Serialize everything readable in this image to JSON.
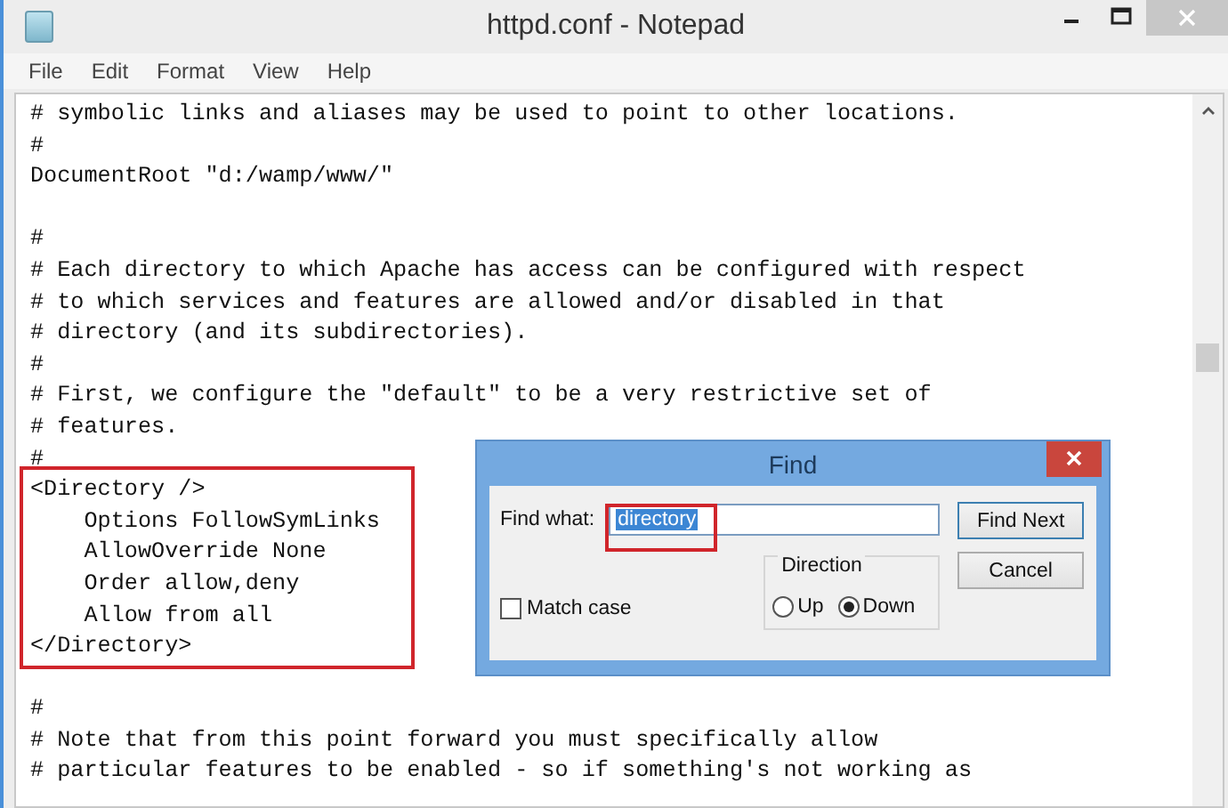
{
  "window": {
    "title": "httpd.conf - Notepad"
  },
  "menu": [
    "File",
    "Edit",
    "Format",
    "View",
    "Help"
  ],
  "editor": {
    "lines": [
      {
        "kind": "text",
        "text": "# symbolic links and aliases may be used to point to other locations."
      },
      {
        "kind": "text",
        "text": "#"
      },
      {
        "kind": "text",
        "text": "DocumentRoot \"d:/wamp/www/\""
      },
      {
        "kind": "blank"
      },
      {
        "kind": "text",
        "text": "#"
      },
      {
        "kind": "text",
        "text": "# Each directory to which Apache has access can be configured with respect"
      },
      {
        "kind": "text",
        "text": "# to which services and features are allowed and/or disabled in that"
      },
      {
        "kind": "text",
        "text": "# directory (and its subdirectories)."
      },
      {
        "kind": "text",
        "text": "#"
      },
      {
        "kind": "text",
        "text": "# First, we configure the \"default\" to be a very restrictive set of"
      },
      {
        "kind": "text",
        "text": "# features."
      },
      {
        "kind": "text",
        "text": "#"
      },
      {
        "kind": "text",
        "text": "<Directory />"
      },
      {
        "kind": "text",
        "text": "    Options FollowSymLinks"
      },
      {
        "kind": "text",
        "text": "    AllowOverride None"
      },
      {
        "kind": "text",
        "text": "    Order allow,deny"
      },
      {
        "kind": "text",
        "text": "    Allow from all"
      },
      {
        "kind": "text",
        "text": "</Directory>"
      },
      {
        "kind": "blank"
      },
      {
        "kind": "text",
        "text": "#"
      },
      {
        "kind": "text",
        "text": "# Note that from this point forward you must specifically allow"
      },
      {
        "kind": "text",
        "text": "# particular features to be enabled - so if something's not working as"
      }
    ]
  },
  "find_dialog": {
    "title": "Find",
    "find_what_label": "Find what:",
    "find_what_value": "directory",
    "value_selected": true,
    "match_case": {
      "label": "Match case",
      "checked": false
    },
    "direction": {
      "label": "Direction",
      "options": [
        {
          "label": "Up",
          "selected": false
        },
        {
          "label": "Down",
          "selected": true
        }
      ]
    },
    "buttons": [
      "Find Next",
      "Cancel"
    ]
  }
}
